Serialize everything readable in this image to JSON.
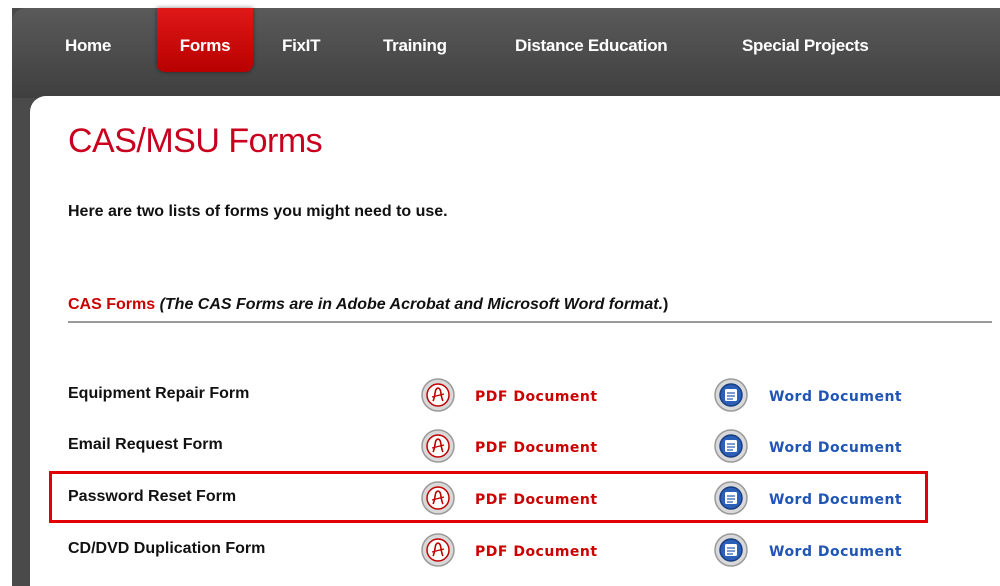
{
  "nav": {
    "items": [
      {
        "label": "Home"
      },
      {
        "label": "Forms"
      },
      {
        "label": "FixIT"
      },
      {
        "label": "Training"
      },
      {
        "label": "Distance Education"
      },
      {
        "label": "Special Projects"
      }
    ],
    "active_index": 1
  },
  "page": {
    "title": "CAS/MSU Forms",
    "intro": "Here are two lists of forms you might need to use."
  },
  "section": {
    "name": "CAS Forms",
    "note": "(The CAS Forms are in Adobe Acrobat and Microsoft Word format.",
    "close_paren": ")"
  },
  "forms": [
    {
      "name": "Equipment Repair Form",
      "pdf_label": "PDF Document",
      "word_label": "Word Document"
    },
    {
      "name": "Email Request Form",
      "pdf_label": "PDF Document",
      "word_label": "Word Document"
    },
    {
      "name": "Password Reset Form",
      "pdf_label": "PDF Document",
      "word_label": "Word Document"
    },
    {
      "name": "CD/DVD Duplication Form",
      "pdf_label": "PDF Document",
      "word_label": "Word Document"
    }
  ],
  "highlighted_row": 2,
  "colors": {
    "accent_red": "#cc0000",
    "link_blue": "#1f55b5",
    "nav_bg": "#4a4a4a",
    "highlight_border": "#e00000"
  },
  "icons": {
    "pdf": "pdf-icon",
    "word": "word-icon"
  }
}
